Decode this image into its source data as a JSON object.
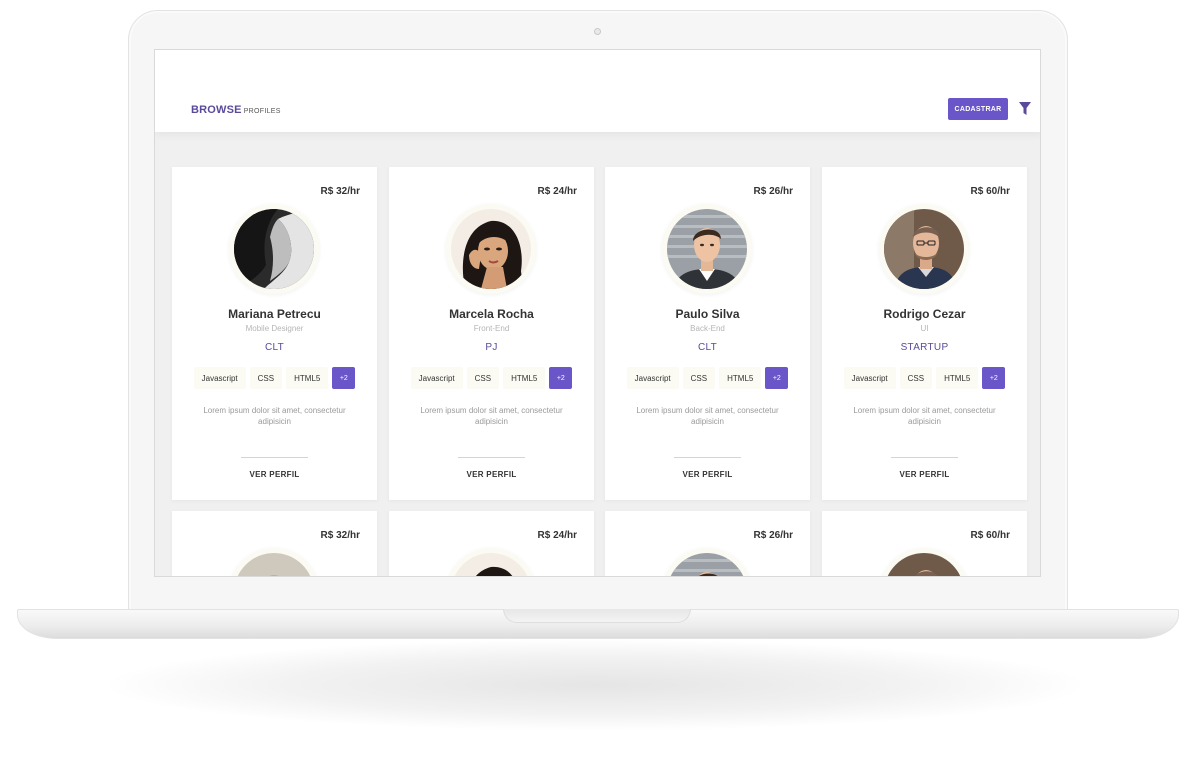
{
  "header": {
    "brand_bold": "BROWSE",
    "brand_small": "PROFILES",
    "cta_label": "CADASTRAR",
    "filter_icon": "filter-icon"
  },
  "colors": {
    "accent": "#6a55c9",
    "brand_text": "#5b4a9a",
    "chip_bg": "#fbfbf3"
  },
  "profiles": [
    {
      "rate": "R$ 32/hr",
      "name": "Mariana Petrecu",
      "role": "Mobile Designer",
      "contract": "CLT",
      "skills": [
        "Javascript",
        "CSS",
        "HTML5"
      ],
      "more": "+2",
      "bio": "Lorem ipsum dolor sit amet, consectetur adipisicin",
      "link": "VER PERFIL"
    },
    {
      "rate": "R$ 24/hr",
      "name": "Marcela Rocha",
      "role": "Front-End",
      "contract": "PJ",
      "skills": [
        "Javascript",
        "CSS",
        "HTML5"
      ],
      "more": "+2",
      "bio": "Lorem ipsum dolor sit amet, consectetur adipisicin",
      "link": "VER PERFIL"
    },
    {
      "rate": "R$ 26/hr",
      "name": "Paulo Silva",
      "role": "Back-End",
      "contract": "CLT",
      "skills": [
        "Javascript",
        "CSS",
        "HTML5"
      ],
      "more": "+2",
      "bio": "Lorem ipsum dolor sit amet, consectetur adipisicin",
      "link": "VER PERFIL"
    },
    {
      "rate": "R$ 60/hr",
      "name": "Rodrigo Cezar",
      "role": "UI",
      "contract": "STARTUP",
      "skills": [
        "Javascript",
        "CSS",
        "HTML5"
      ],
      "more": "+2",
      "bio": "Lorem ipsum dolor sit amet, consectetur adipisicin",
      "link": "VER PERFIL"
    }
  ],
  "profiles_row2": [
    {
      "rate": "R$ 32/hr"
    },
    {
      "rate": "R$ 24/hr"
    },
    {
      "rate": "R$ 26/hr"
    },
    {
      "rate": "R$ 60/hr"
    }
  ]
}
